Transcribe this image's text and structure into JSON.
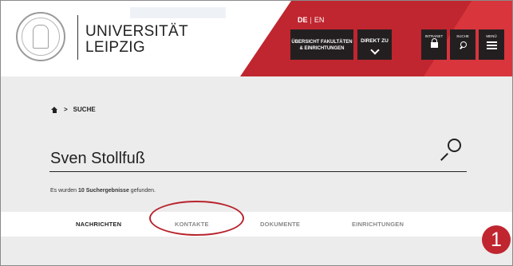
{
  "header": {
    "logo_line1": "UNIVERSITÄT",
    "logo_line2": "LEIPZIG",
    "lang_active": "DE",
    "lang_separator": "|",
    "lang_other": "EN",
    "nav_faculties_line1": "ÜBERSICHT FAKULTÄTEN",
    "nav_faculties_line2": "& EINRICHTUNGEN",
    "nav_direkt": "DIREKT ZU",
    "nav_intranet": "INTRANET",
    "nav_suche": "SUCHE",
    "nav_menu": "MENÜ",
    "colors": {
      "primary_red": "#c0262f",
      "light_red": "#d8353c",
      "dark_button": "#231f20"
    }
  },
  "breadcrumb": {
    "home_icon": "home-icon",
    "separator": ">",
    "current": "SUCHE"
  },
  "search": {
    "query": "Sven Stollfuß",
    "icon": "search-icon"
  },
  "results": {
    "prefix": "Es wurden",
    "count_text": "10 Suchergebnisse",
    "suffix": "gefunden."
  },
  "tabs": [
    {
      "label": "NACHRICHTEN",
      "active": true
    },
    {
      "label": "KONTAKTE",
      "active": false
    },
    {
      "label": "DOKUMENTE",
      "active": false
    },
    {
      "label": "EINRICHTUNGEN",
      "active": false
    }
  ],
  "annotation": {
    "step_number": "1",
    "highlight_color": "#b8232c"
  }
}
